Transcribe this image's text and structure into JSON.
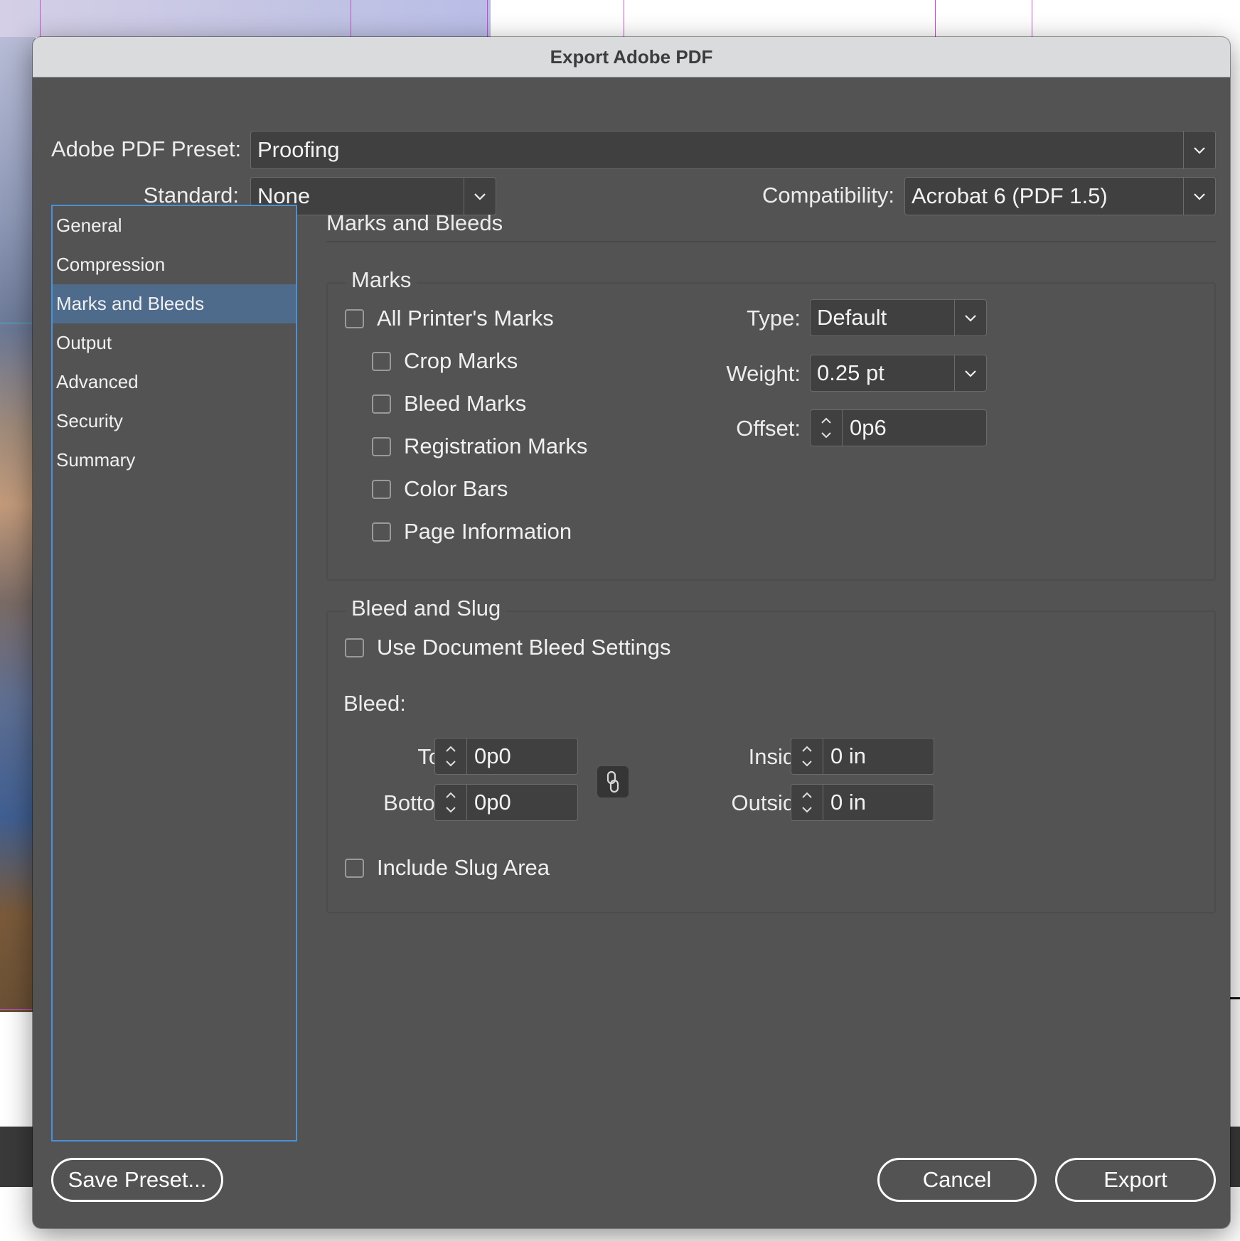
{
  "dialog": {
    "title": "Export Adobe PDF"
  },
  "preset": {
    "label": "Adobe PDF Preset:",
    "value": "Proofing"
  },
  "standard": {
    "label": "Standard:",
    "value": "None"
  },
  "compatibility": {
    "label": "Compatibility:",
    "value": "Acrobat 6 (PDF 1.5)"
  },
  "sidebar": {
    "items": [
      {
        "label": "General"
      },
      {
        "label": "Compression"
      },
      {
        "label": "Marks and Bleeds",
        "selected": true
      },
      {
        "label": "Output"
      },
      {
        "label": "Advanced"
      },
      {
        "label": "Security"
      },
      {
        "label": "Summary"
      }
    ]
  },
  "panel": {
    "title": "Marks and Bleeds",
    "marks": {
      "title": "Marks",
      "all_printers_marks": {
        "label": "All Printer's Marks",
        "checked": false
      },
      "crop_marks": {
        "label": "Crop Marks",
        "checked": false
      },
      "bleed_marks": {
        "label": "Bleed Marks",
        "checked": false
      },
      "registration_marks": {
        "label": "Registration Marks",
        "checked": false
      },
      "color_bars": {
        "label": "Color Bars",
        "checked": false
      },
      "page_information": {
        "label": "Page Information",
        "checked": false
      },
      "type": {
        "label": "Type:",
        "value": "Default"
      },
      "weight": {
        "label": "Weight:",
        "value": "0.25 pt"
      },
      "offset": {
        "label": "Offset:",
        "value": "0p6"
      }
    },
    "bleed_slug": {
      "title": "Bleed and Slug",
      "use_document_bleed": {
        "label": "Use Document Bleed Settings",
        "checked": false
      },
      "bleed_label": "Bleed:",
      "top": {
        "label": "Top:",
        "value": "0p0"
      },
      "bottom": {
        "label": "Bottom:",
        "value": "0p0"
      },
      "inside": {
        "label": "Inside:",
        "value": "0 in"
      },
      "outside": {
        "label": "Outside:",
        "value": "0 in"
      },
      "include_slug": {
        "label": "Include Slug Area",
        "checked": false
      }
    }
  },
  "buttons": {
    "save_preset": "Save Preset...",
    "cancel": "Cancel",
    "export": "Export"
  },
  "colors": {
    "dialog_bg": "#535353",
    "field_bg": "#404040",
    "selection": "#4e6b8c",
    "focus_ring": "#4a90d9"
  },
  "icons": [
    "chevron-down-icon",
    "stepper-icon",
    "chain-link-icon"
  ]
}
